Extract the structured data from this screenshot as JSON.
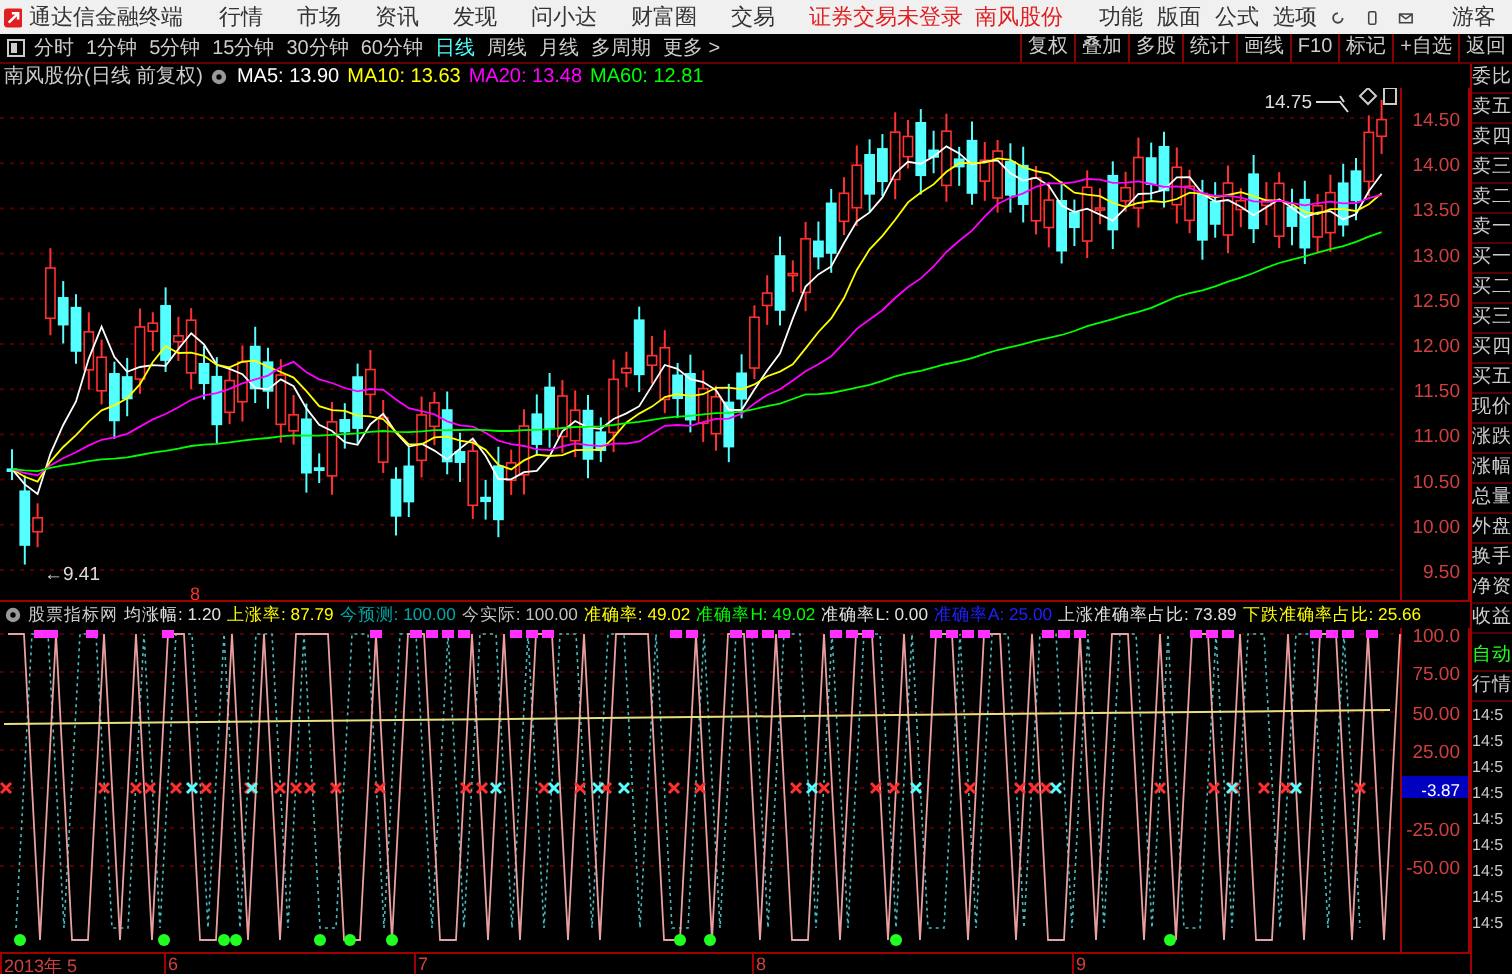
{
  "menu_bar": {
    "app_title": "通达信金融终端",
    "menus": [
      "行情",
      "市场",
      "资讯",
      "发现",
      "问小达",
      "财富圈",
      "交易"
    ],
    "login_status": "证券交易未登录",
    "stock_name": "南风股份",
    "right_menus": [
      "功能",
      "版面",
      "公式",
      "选项"
    ],
    "user": "游客"
  },
  "toolbar": {
    "periods": [
      {
        "label": "分时",
        "selected": false
      },
      {
        "label": "1分钟",
        "selected": false
      },
      {
        "label": "5分钟",
        "selected": false
      },
      {
        "label": "15分钟",
        "selected": false
      },
      {
        "label": "30分钟",
        "selected": false
      },
      {
        "label": "60分钟",
        "selected": false
      },
      {
        "label": "日线",
        "selected": true
      },
      {
        "label": "周线",
        "selected": false
      },
      {
        "label": "月线",
        "selected": false
      },
      {
        "label": "多周期",
        "selected": false
      }
    ],
    "more": "更多 >",
    "buttons": [
      "复权",
      "叠加",
      "多股",
      "统计",
      "画线",
      "F10",
      "标记",
      "+自选",
      "返回"
    ]
  },
  "main_chart": {
    "title": "南风股份(日线 前复权)",
    "ma_legend": [
      {
        "text": "MA5: 13.90",
        "color": "#ffffff"
      },
      {
        "text": "MA10: 13.63",
        "color": "#ffff00"
      },
      {
        "text": "MA20: 13.48",
        "color": "#ff00ff"
      },
      {
        "text": "MA60: 12.81",
        "color": "#00ff00"
      }
    ],
    "high_label": "14.75",
    "low_label": "←9.41",
    "marker": "8",
    "price_ticks": [
      "14.50",
      "14.00",
      "13.50",
      "13.00",
      "12.50",
      "12.00",
      "11.50",
      "11.00",
      "10.50",
      "10.00",
      "9.50"
    ]
  },
  "indicator": {
    "name": "股票指标网",
    "legend": [
      {
        "text": "均涨幅: 1.20",
        "color": "#e0e0e0"
      },
      {
        "text": "上涨率: 87.79",
        "color": "#ffff00"
      },
      {
        "text": "今预测: 100.00",
        "color": "#00a8a8"
      },
      {
        "text": "今实际: 100.00",
        "color": "#c0c0c0"
      },
      {
        "text": "准确率: 49.02",
        "color": "#ffff00"
      },
      {
        "text": "准确率H: 49.02",
        "color": "#00ff00"
      },
      {
        "text": "准确率L: 0.00",
        "color": "#e0e0e0"
      },
      {
        "text": "准确率A: 25.00",
        "color": "#2020ff"
      },
      {
        "text": "上涨准确率占比: 73.89",
        "color": "#e0e0e0"
      },
      {
        "text": "下跌准确率占比: 25.66",
        "color": "#ffff00"
      }
    ],
    "ticks": [
      {
        "label": "100.0",
        "kind": "plain"
      },
      {
        "label": "75.00",
        "kind": "plain"
      },
      {
        "label": "50.00",
        "kind": "plain"
      },
      {
        "label": "25.00",
        "kind": "plain"
      },
      {
        "label": "-3.87",
        "kind": "current"
      },
      {
        "label": "-25.00",
        "kind": "plain"
      },
      {
        "label": "-50.00",
        "kind": "plain"
      }
    ]
  },
  "side_panel": {
    "quote_labels": [
      "委比",
      "卖五",
      "卖四",
      "卖三",
      "卖二",
      "卖一",
      "买一",
      "买二",
      "买三",
      "买四",
      "买五",
      "现价",
      "涨跌",
      "涨幅",
      "总量",
      "外盘",
      "换手",
      "净资",
      "收益"
    ],
    "auto_label": "自动",
    "quote_tab": "行情",
    "times": [
      "14:5",
      "14:5",
      "14:5",
      "14:5",
      "14:5",
      "14:5",
      "14:5",
      "14:5",
      "14:5"
    ]
  },
  "date_axis": [
    "2013年 5",
    "6",
    "7",
    "8",
    "9"
  ]
}
